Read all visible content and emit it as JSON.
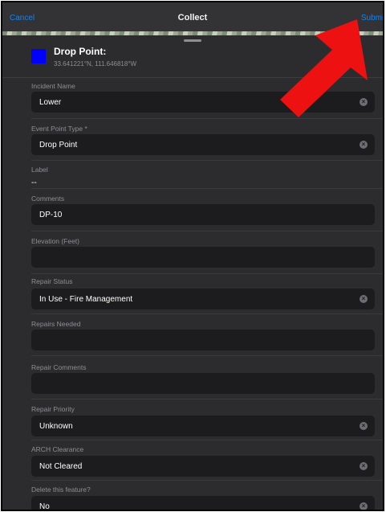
{
  "nav": {
    "cancel": "Cancel",
    "title": "Collect",
    "submit": "Submit"
  },
  "header": {
    "title": "Drop Point:",
    "coords": "33.641221°N, 111.646818°W",
    "swatch_color": "#0000ff"
  },
  "fields": [
    {
      "label": "Incident Name",
      "value": "Lower",
      "clear": true
    },
    {
      "label": "Event Point Type *",
      "value": "Drop Point",
      "clear": true
    },
    {
      "label": "Label",
      "value": "--"
    },
    {
      "label": "Comments",
      "value": "DP-10"
    },
    {
      "label": "Elevation (Feet)",
      "value": ""
    },
    {
      "label": "Repair Status",
      "value": "In Use - Fire Management",
      "clear": true
    },
    {
      "label": "Repairs Needed",
      "value": ""
    },
    {
      "label": "Repair Comments",
      "value": ""
    },
    {
      "label": "Repair Priority",
      "value": "Unknown",
      "clear": true
    },
    {
      "label": "ARCH Clearance",
      "value": "Not Cleared",
      "clear": true
    },
    {
      "label": "Delete this feature?",
      "value": "No",
      "clear": true
    }
  ],
  "colors": {
    "accent": "#0a84ff",
    "arrow": "#ee1111"
  },
  "icons": {
    "clear": "clear-circle-icon",
    "arrow": "annotation-arrow-icon"
  }
}
